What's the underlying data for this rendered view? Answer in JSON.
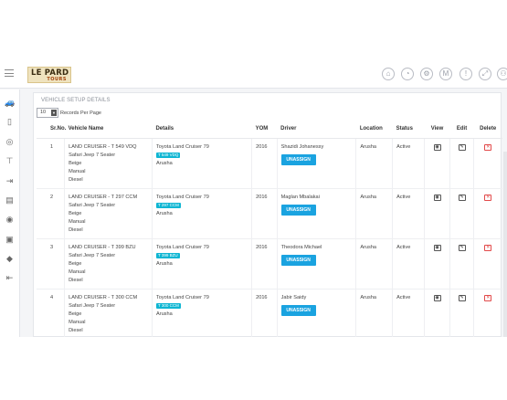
{
  "header": {
    "logo_main": "LE PARD",
    "logo_sub": "TOURS",
    "icons": [
      {
        "name": "home-icon",
        "glyph": "⌂",
        "badge": ""
      },
      {
        "name": "pie-chart-icon",
        "glyph": "◔",
        "badge": ""
      },
      {
        "name": "settings-icon",
        "glyph": "⚙",
        "badge": ""
      },
      {
        "name": "mail-icon",
        "glyph": "M",
        "badge": "0"
      },
      {
        "name": "notification-icon",
        "glyph": "!",
        "badge": "0"
      },
      {
        "name": "expand-icon",
        "glyph": "⤢",
        "badge": ""
      },
      {
        "name": "user-icon",
        "glyph": "⚇",
        "badge": ""
      }
    ]
  },
  "sidebar": {
    "icons": [
      "car-icon",
      "book-icon",
      "target-icon",
      "pin-icon",
      "login-icon",
      "document-icon",
      "steering-icon",
      "fuel-pump-icon",
      "drop-icon",
      "logout-icon"
    ]
  },
  "card": {
    "title": "VEHICLE SETUP DETAILS",
    "records_value": "10",
    "records_label": "Records Per Page"
  },
  "table": {
    "headers": {
      "srno": "Sr.No.",
      "vehicle": "Vehicle Name",
      "details": "Details",
      "yom": "YOM",
      "driver": "Driver",
      "location": "Location",
      "status": "Status",
      "view": "View",
      "edit": "Edit",
      "delete": "Delete"
    },
    "unassign_label": "UNASSIGN",
    "rows": [
      {
        "srno": "1",
        "name": "LAND CRUISER - T 549 VDQ",
        "type": "Safari Jeep 7 Seater",
        "color": "Beige",
        "trans": "Manual",
        "fuel": "Diesel",
        "model": "Toyota  Land Cruiser 79",
        "reg": "T 549 VDQ",
        "city": "Arusha",
        "yom": "2016",
        "driver": "Shazidi Johanessy",
        "location": "Arusha",
        "status": "Active"
      },
      {
        "srno": "2",
        "name": "LAND CRUISER - T 297 CCM",
        "type": "Safari Jeep 7 Seater",
        "color": "Beige",
        "trans": "Manual",
        "fuel": "Diesel",
        "model": "Toyota  Land Cruiser 79",
        "reg": "T 297 CCM",
        "city": "Arusha",
        "yom": "2016",
        "driver": "Maglan Mbalakai",
        "location": "Arusha",
        "status": "Active"
      },
      {
        "srno": "3",
        "name": "LAND CRUISER - T 399 BZU",
        "type": "Safari Jeep 7 Seater",
        "color": "Beige",
        "trans": "Manual",
        "fuel": "Diesel",
        "model": "Toyota  Land Cruiser 79",
        "reg": "T 399 BZU",
        "city": "Arusha",
        "yom": "2016",
        "driver": "Theodora Michael",
        "location": "Arusha",
        "status": "Active"
      },
      {
        "srno": "4",
        "name": "LAND CRUISER - T 300 CCM",
        "type": "Safari Jeep 7 Seater",
        "color": "Beige",
        "trans": "Manual",
        "fuel": "Diesel",
        "model": "Toyota  Land Cruiser 79",
        "reg": "T 300 CCM",
        "city": "Arusha",
        "yom": "2016",
        "driver": "Jabir Saidy",
        "location": "Arusha",
        "status": "Active"
      }
    ]
  }
}
